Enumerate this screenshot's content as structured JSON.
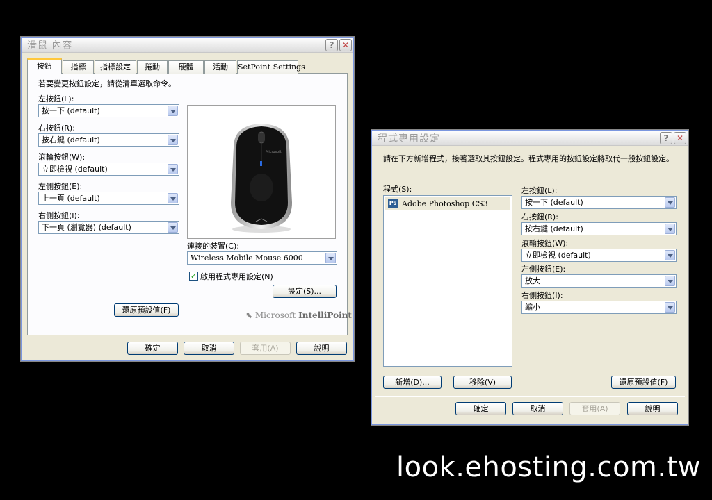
{
  "mouse_dialog": {
    "title": "滑鼠 內容",
    "help_btn": "?",
    "close_btn": "✕",
    "tabs": [
      "按鈕",
      "指標",
      "指標設定",
      "捲動",
      "硬體",
      "活動",
      "SetPoint Settings"
    ],
    "instruction": "若要變更按鈕設定，請從清單選取命令。",
    "left_button_label": "左按鈕(L):",
    "left_button_value": "按一下 (default)",
    "right_button_label": "右按鈕(R):",
    "right_button_value": "按右鍵 (default)",
    "wheel_button_label": "滾輪按鈕(W):",
    "wheel_button_value": "立即檢視 (default)",
    "left_side_label": "左側按鈕(E):",
    "left_side_value": "上一頁 (default)",
    "right_side_label": "右側按鈕(I):",
    "right_side_value": "下一頁 (瀏覽器) (default)",
    "connected_device_label": "連接的裝置(C):",
    "connected_device_value": "Wireless Mobile Mouse 6000",
    "enable_program_settings": "啟用程式專用設定(N)",
    "enable_program_checked": "✓",
    "settings_btn": "設定(S)...",
    "restore_defaults_btn": "還原預設值(F)",
    "brand_ms": "Microsoft ",
    "brand_ip": "IntelliPoint",
    "mouse_logo": "Microsoft",
    "ok_btn": "確定",
    "cancel_btn": "取消",
    "apply_btn": "套用(A)",
    "help_text_btn": "說明"
  },
  "program_dialog": {
    "title": "程式專用設定",
    "help_btn": "?",
    "close_btn": "✕",
    "instruction": "請在下方新增程式，接著選取其按鈕設定。程式專用的按鈕設定將取代一般按鈕設定。",
    "program_label": "程式(S):",
    "program_item": "Adobe Photoshop CS3",
    "program_icon": "Ps",
    "left_button_label": "左按鈕(L):",
    "left_button_value": "按一下 (default)",
    "right_button_label": "右按鈕(R):",
    "right_button_value": "按右鍵 (default)",
    "wheel_button_label": "滾輪按鈕(W):",
    "wheel_button_value": "立即檢視 (default)",
    "left_side_label": "左側按鈕(E):",
    "left_side_value": "放大",
    "right_side_label": "右側按鈕(I):",
    "right_side_value": "縮小",
    "add_btn": "新增(D)...",
    "remove_btn": "移除(V)",
    "restore_defaults_btn": "還原預設值(F)",
    "ok_btn": "確定",
    "cancel_btn": "取消",
    "apply_btn": "套用(A)",
    "help_text_btn": "說明"
  },
  "watermark": "look.ehosting.com.tw"
}
